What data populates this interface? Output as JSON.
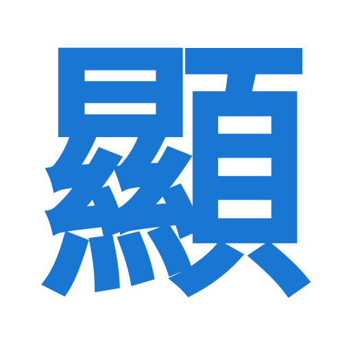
{
  "character": "顯",
  "colors": {
    "glyph": "#1976d2",
    "background": "#ffffff"
  }
}
